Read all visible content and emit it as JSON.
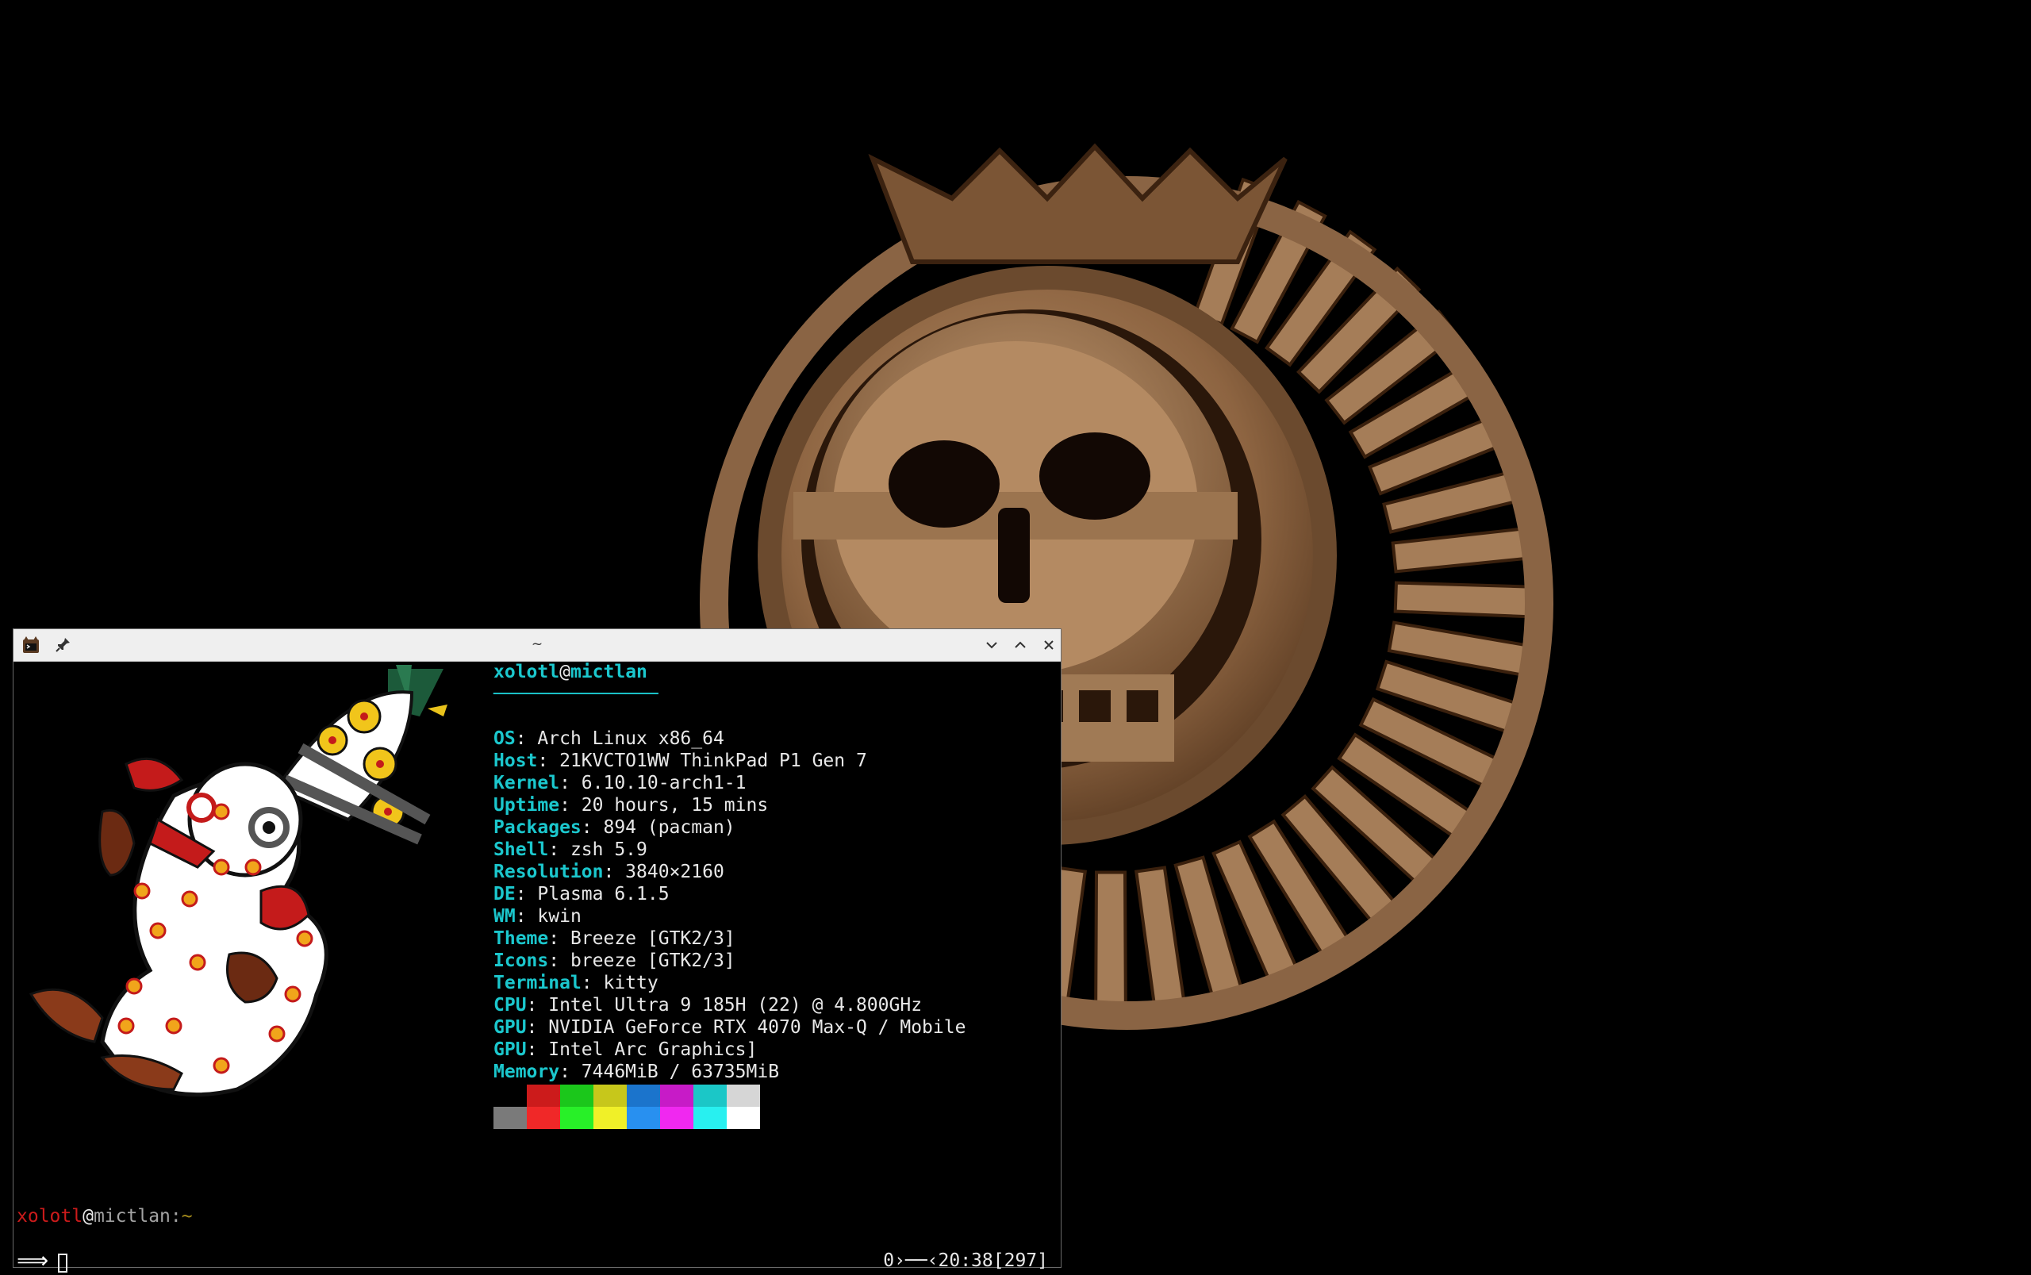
{
  "window": {
    "title": "~",
    "app_icon": "kitty-cat-icon",
    "pin_icon": "pin-icon",
    "minimize_icon": "chevron-down-icon",
    "maximize_icon": "chevron-up-icon",
    "close_icon": "close-icon"
  },
  "neofetch": {
    "user": "xolotl",
    "at": "@",
    "host": "mictlan",
    "separator": "───────────────",
    "fields": [
      {
        "key": "OS",
        "value": ": Arch Linux x86_64"
      },
      {
        "key": "Host",
        "value": ": 21KVCTO1WW ThinkPad P1 Gen 7"
      },
      {
        "key": "Kernel",
        "value": ": 6.10.10-arch1-1"
      },
      {
        "key": "Uptime",
        "value": ": 20 hours, 15 mins"
      },
      {
        "key": "Packages",
        "value": ": 894 (pacman)"
      },
      {
        "key": "Shell",
        "value": ": zsh 5.9"
      },
      {
        "key": "Resolution",
        "value": ": 3840×2160"
      },
      {
        "key": "DE",
        "value": ": Plasma 6.1.5"
      },
      {
        "key": "WM",
        "value": ": kwin"
      },
      {
        "key": "Theme",
        "value": ": Breeze [GTK2/3]"
      },
      {
        "key": "Icons",
        "value": ": breeze [GTK2/3]"
      },
      {
        "key": "Terminal",
        "value": ": kitty"
      },
      {
        "key": "CPU",
        "value": ": Intel Ultra 9 185H (22) @ 4.800GHz"
      },
      {
        "key": "GPU",
        "value": ": NVIDIA GeForce RTX 4070 Max-Q / Mobile"
      },
      {
        "key": "GPU",
        "value": ": Intel Arc Graphics]"
      },
      {
        "key": "Memory",
        "value": ": 7446MiB / 63735MiB"
      }
    ],
    "palette_normal": [
      "#000000",
      "#cc1b1b",
      "#1bc71b",
      "#c7c71b",
      "#1b74cc",
      "#c71bc7",
      "#1bc7c7",
      "#d6d6d6"
    ],
    "palette_bright": [
      "#7a7a7a",
      "#f02828",
      "#28f028",
      "#f0f028",
      "#2890f0",
      "#f028f0",
      "#28f0f0",
      "#ffffff"
    ]
  },
  "prompt": {
    "user": "xolotl",
    "at": "@",
    "host": "mictlan",
    "colon": ":",
    "path": "~",
    "arrow": "⟹",
    "right_prompt": "0›──‹20:38[297]"
  }
}
